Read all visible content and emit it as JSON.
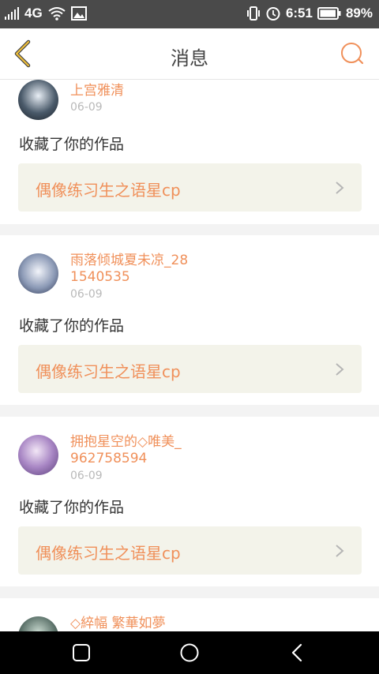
{
  "status": {
    "network": "4G",
    "time": "6:51",
    "battery": "89%",
    "icons": [
      "signal-icon",
      "wifi-icon",
      "image-icon",
      "vibrate-icon",
      "alarm-icon",
      "battery-icon"
    ]
  },
  "header": {
    "title": "消息",
    "back_icon": "chevron-left-icon",
    "search_icon": "search-icon"
  },
  "messages": [
    {
      "user": "上宫雅清",
      "date": "06-09",
      "action": "收藏了你的作品",
      "work": "偶像练习生之语星cp"
    },
    {
      "user": "雨落倾城夏未凉_281540535",
      "date": "06-09",
      "action": "收藏了你的作品",
      "work": "偶像练习生之语星cp"
    },
    {
      "user": "拥抱星空的◇唯美_962758594",
      "date": "06-09",
      "action": "收藏了你的作品",
      "work": "偶像练习生之语星cp"
    },
    {
      "user": "◇綷幅 繁華如夢",
      "date": "",
      "action": "",
      "work": ""
    }
  ],
  "colors": {
    "accent": "#f0905a",
    "back_icon": "#f0c03a",
    "work_bg": "#f3f3ea"
  },
  "system_nav": [
    "recents-button",
    "home-button",
    "back-button"
  ]
}
